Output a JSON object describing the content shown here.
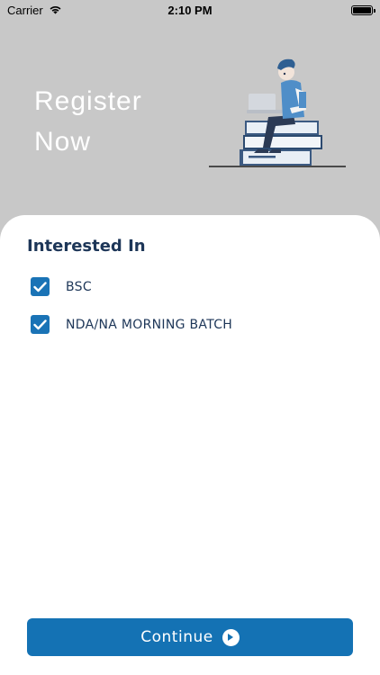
{
  "status_bar": {
    "carrier": "Carrier",
    "time": "2:10 PM",
    "icons": [
      "wifi-icon",
      "battery-icon"
    ]
  },
  "header": {
    "title_line1": "Register",
    "title_line2": "Now",
    "illustration": "person-on-books-laptop-illustration"
  },
  "form": {
    "section_title": "Interested In",
    "options": [
      {
        "label": "BSC",
        "checked": true
      },
      {
        "label": "NDA/NA MORNING BATCH",
        "checked": true
      }
    ]
  },
  "footer": {
    "continue_label": "Continue",
    "continue_icon": "play-circle-icon"
  },
  "colors": {
    "header_bg": "#c8c8c8",
    "accent": "#1472b4",
    "text_dark": "#1d3658"
  }
}
